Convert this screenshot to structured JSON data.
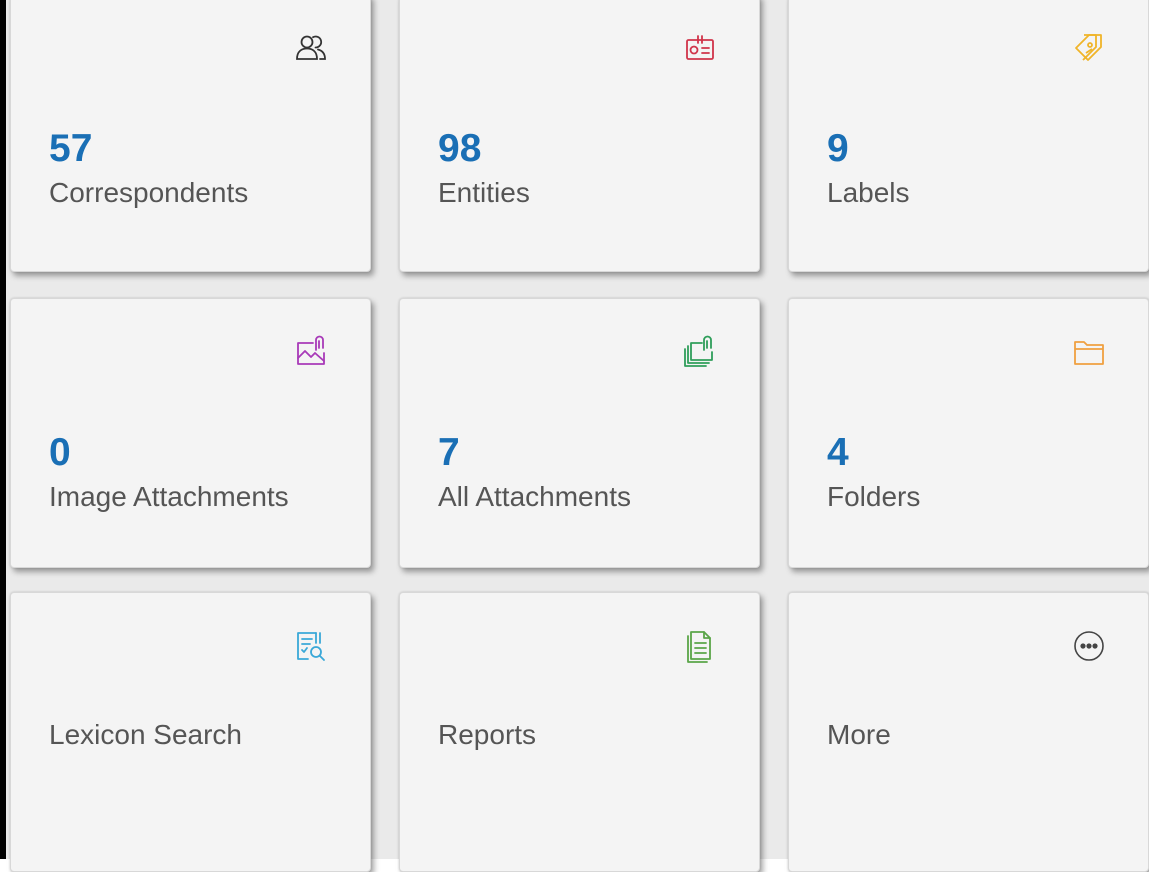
{
  "tiles": [
    {
      "count": "57",
      "label": "Correspondents",
      "icon": "people-icon",
      "color": "#333333"
    },
    {
      "count": "98",
      "label": "Entities",
      "icon": "id-card-icon",
      "color": "#d0344a"
    },
    {
      "count": "9",
      "label": "Labels",
      "icon": "tag-icon",
      "color": "#f0b429"
    },
    {
      "count": "0",
      "label": "Image Attachments",
      "icon": "image-attachment-icon",
      "color": "#a83ab8"
    },
    {
      "count": "7",
      "label": "All Attachments",
      "icon": "attachments-icon",
      "color": "#2f9e5a"
    },
    {
      "count": "4",
      "label": "Folders",
      "icon": "folder-icon",
      "color": "#f0a040"
    },
    {
      "label": "Lexicon Search",
      "icon": "lexicon-search-icon",
      "color": "#3aa8d8"
    },
    {
      "label": "Reports",
      "icon": "report-document-icon",
      "color": "#5aa548"
    },
    {
      "label": "More",
      "icon": "more-icon",
      "color": "#444444"
    }
  ]
}
